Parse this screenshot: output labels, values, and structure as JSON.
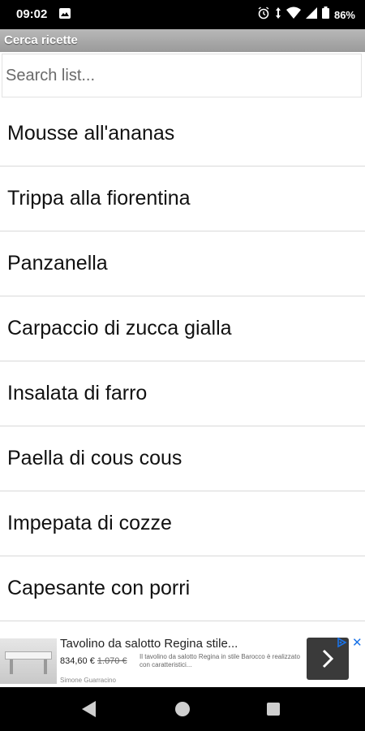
{
  "status_bar": {
    "time": "09:02",
    "battery": "86%",
    "icons": [
      "gallery-icon",
      "alarm-icon",
      "data-arrows-icon",
      "wifi-icon",
      "signal-icon",
      "battery-icon"
    ]
  },
  "app": {
    "title": "Cerca ricette"
  },
  "search": {
    "placeholder": "Search list..."
  },
  "recipes": [
    "Mousse all'ananas",
    "Trippa alla fiorentina",
    "Panzanella",
    "Carpaccio di zucca gialla",
    "Insalata di farro",
    "Paella di cous cous",
    "Impepata di cozze",
    "Capesante con porri"
  ],
  "ad": {
    "title": "Tavolino da salotto Regina stile...",
    "price": "834,60 €",
    "old_price": "1.070 €",
    "description": "Il tavolino da salotto Regina in stile Barocco è realizzato con caratteristici...",
    "brand": "Simone Guarracino"
  },
  "colors": {
    "title_bar": "#a8a8a8",
    "ad_cta": "#3a3a3a",
    "adchoices": "#1a73e8"
  }
}
